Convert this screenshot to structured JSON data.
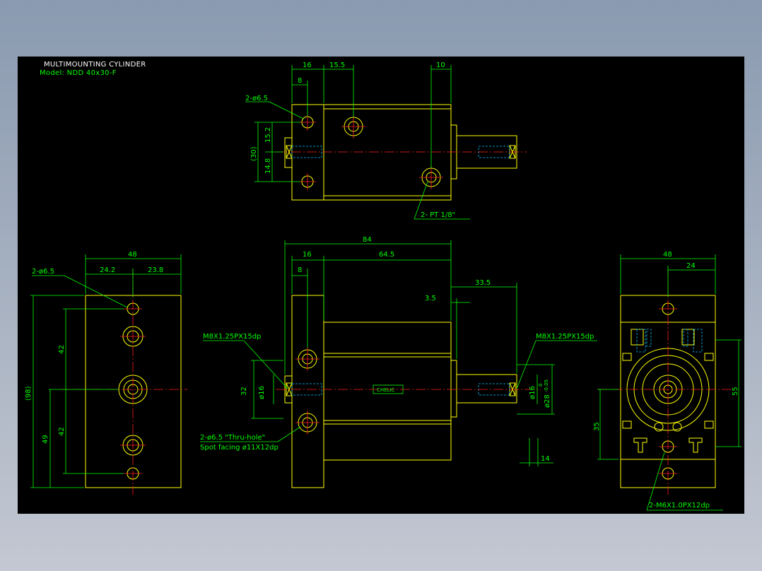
{
  "header": {
    "title": "MULTIMOUNTING CYLINDER",
    "model": "Model: NDD 40x30-F"
  },
  "colors": {
    "background": "#000000",
    "outline": "#ffff00",
    "dimension": "#00ff00",
    "centerline": "#ff2020",
    "hidden": "#00bfff",
    "text_white": "#ffffff"
  },
  "top_view": {
    "dim_16": "16",
    "dim_15_5": "15.5",
    "dim_10": "10",
    "dim_8": "8",
    "dim_15_2": "15.2",
    "dim_14_8": "14.8",
    "dim_30": "(30)",
    "holes_label": "2-ø6.5",
    "port_label": "2- PT 1/8\""
  },
  "front_view": {
    "dim_84": "84",
    "dim_16": "16",
    "dim_64_5": "64.5",
    "dim_8": "8",
    "dim_33_5": "33.5",
    "dim_3_5": "3.5",
    "dim_32": "32",
    "dim_14": "14",
    "left_thread": "M8X1.25PX15dp",
    "right_thread": "M8X1.25PX15dp",
    "left_bore": "ø16",
    "right_bore": "ø16",
    "rod_dia": "ø28",
    "rod_tol": "-0.05",
    "rod_tol2": "0",
    "holes_note": "2-ø6.5 \"Thru-hole\"",
    "spot_note": "Spot facing  ø11X12dp",
    "nameplate": "CHELIC"
  },
  "left_view": {
    "dim_48": "48",
    "dim_24_2": "24.2",
    "dim_23_8": "23.8",
    "dim_98": "(98)",
    "dim_42a": "42",
    "dim_42b": "42",
    "dim_49": "49",
    "holes_label": "2-ø6.5"
  },
  "right_view": {
    "dim_48": "48",
    "dim_24": "24",
    "dim_55": "55",
    "dim_35": "35",
    "thread_label": "2-M6X1.0PX12dp"
  }
}
